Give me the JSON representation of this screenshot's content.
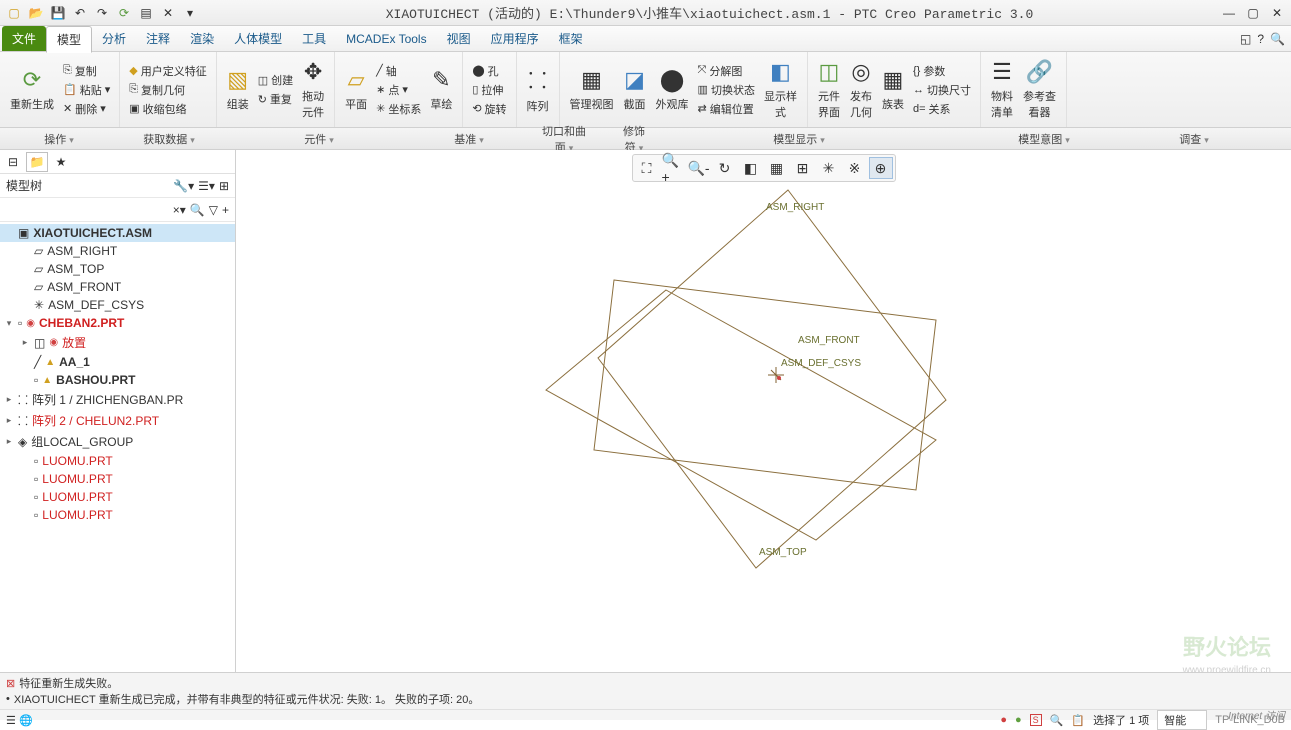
{
  "title": "XIAOTUICHECT (活动的) E:\\Thunder9\\小推车\\xiaotuichect.asm.1 - PTC Creo Parametric 3.0",
  "menu": {
    "file": "文件",
    "tabs": [
      "模型",
      "分析",
      "注释",
      "渲染",
      "人体模型",
      "工具",
      "MCADEx Tools",
      "视图",
      "应用程序",
      "框架"
    ]
  },
  "ribbon": {
    "regen": "重新生成",
    "copy": "复制",
    "paste": "粘贴",
    "delete": "删除",
    "udf": "用户定义特征",
    "copygeom": "复制几何",
    "shrinkwrap": "收缩包络",
    "assemble": "组装",
    "create": "创建",
    "repeat": "重复",
    "dragcomp": "拖动\n元件",
    "plane": "平面",
    "axis": "轴",
    "point": "点",
    "csys": "坐标系",
    "sketch": "草绘",
    "hole": "孔",
    "extrude": "拉伸",
    "revolve": "旋转",
    "pattern": "阵列",
    "managev": "管理视图",
    "section": "截面",
    "appearance": "外观库",
    "explode": "分解图",
    "switchst": "切换状态",
    "editpos": "编辑位置",
    "dispstyle": "显示样\n式",
    "compif": "元件\n界面",
    "pubgeom": "发布\n几何",
    "family": "族表",
    "param": "参数",
    "switchdim": "切换尺寸",
    "relation": "关系",
    "bom": "物料\n清单",
    "refview": "参考查\n看器"
  },
  "subribbon": [
    "操作",
    "获取数据",
    "元件",
    "基准",
    "切口和曲面",
    "修饰符",
    "模型显示",
    "模型意图",
    "调查"
  ],
  "tree": {
    "header": "模型树",
    "items": [
      {
        "label": "XIAOTUICHECT.ASM",
        "icon": "asm",
        "sel": true,
        "bold": true,
        "indent": 0,
        "exp": ""
      },
      {
        "label": "ASM_RIGHT",
        "icon": "plane",
        "indent": 1
      },
      {
        "label": "ASM_TOP",
        "icon": "plane",
        "indent": 1
      },
      {
        "label": "ASM_FRONT",
        "icon": "plane",
        "indent": 1
      },
      {
        "label": "ASM_DEF_CSYS",
        "icon": "csys",
        "indent": 1
      },
      {
        "label": "CHEBAN2.PRT",
        "icon": "prt",
        "red": true,
        "bold": true,
        "indent": 0,
        "exp": "▾",
        "warn": true
      },
      {
        "label": "放置",
        "icon": "place",
        "red": true,
        "indent": 1,
        "exp": "▸",
        "warn": true
      },
      {
        "label": "AA_1",
        "icon": "axis",
        "bold": true,
        "indent": 1,
        "warn2": true
      },
      {
        "label": "BASHOU.PRT",
        "icon": "prt",
        "bold": true,
        "indent": 1,
        "warn2": true
      },
      {
        "label": "阵列 1 / ZHICHENGBAN.PR",
        "icon": "pattern",
        "indent": 0,
        "exp": "▸"
      },
      {
        "label": "阵列 2 / CHELUN2.PRT",
        "icon": "pattern",
        "red": true,
        "indent": 0,
        "exp": "▸"
      },
      {
        "label": "组LOCAL_GROUP",
        "icon": "group",
        "indent": 0,
        "exp": "▸"
      },
      {
        "label": "LUOMU.PRT",
        "icon": "prt",
        "red": true,
        "indent": 1
      },
      {
        "label": "LUOMU.PRT",
        "icon": "prt",
        "red": true,
        "indent": 1
      },
      {
        "label": "LUOMU.PRT",
        "icon": "prt",
        "red": true,
        "indent": 1
      },
      {
        "label": "LUOMU.PRT",
        "icon": "prt",
        "red": true,
        "indent": 1
      }
    ]
  },
  "canvas": {
    "labels": {
      "right": "ASM_RIGHT",
      "front": "ASM_FRONT",
      "top": "ASM_TOP",
      "csys": "ASM_DEF_CSYS"
    }
  },
  "status": {
    "msg1": "特征重新生成失败。",
    "msg2": "XIAOTUICHECT 重新生成已完成，并带有非典型的特征或元件状况: 失败: 1。  失败的子项: 20。",
    "sel": "选择了 1 项",
    "smart": "智能",
    "net1": "TP-LINK_D0B",
    "net2": "Internet 访问"
  },
  "watermark": "野火论坛",
  "watermark_sub": "www.proewildfire.cn"
}
